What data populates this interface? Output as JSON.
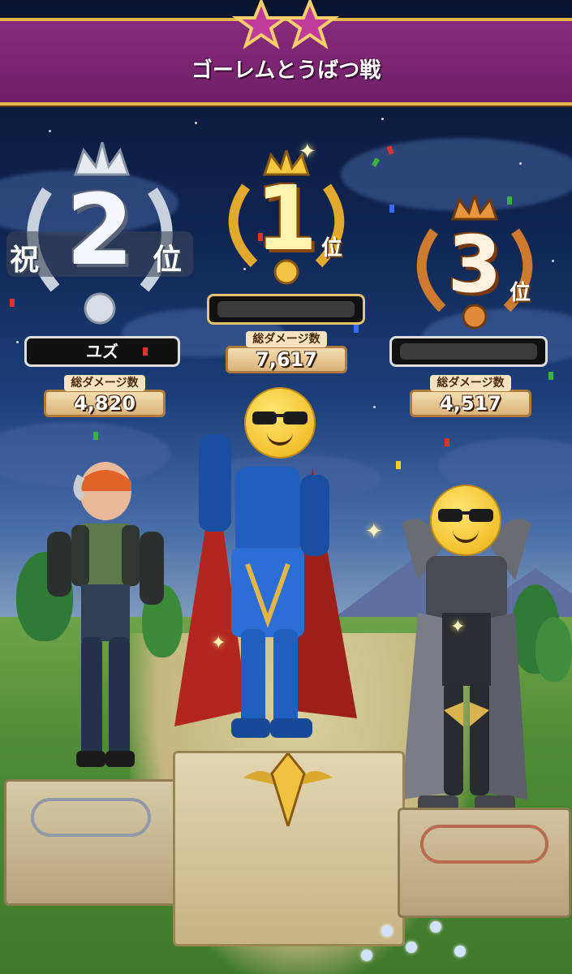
{
  "header": {
    "title": "ゴーレムとうばつ戦"
  },
  "rankings": [
    {
      "place": "2",
      "prefix": "祝",
      "suffix": "位",
      "name": "ユズ",
      "damage_label": "総ダメージ数",
      "damage_value": "4,820"
    },
    {
      "place": "1",
      "prefix": "",
      "suffix": "位",
      "name": "",
      "damage_label": "総ダメージ数",
      "damage_value": "7,617"
    },
    {
      "place": "3",
      "prefix": "",
      "suffix": "位",
      "name": "",
      "damage_label": "総ダメージ数",
      "damage_value": "4,517"
    }
  ],
  "colors": {
    "banner": "#8a2a7c",
    "gold": "#e2b64a",
    "silver": "#cfd6df",
    "bronze": "#d88a3c"
  },
  "icons": {
    "header": "star-icon",
    "rank_1": "gold-crown-laurel-icon",
    "rank_2": "silver-crown-laurel-icon",
    "rank_3": "bronze-crown-laurel-icon",
    "face_cover": "sunglasses-emoji-icon"
  }
}
